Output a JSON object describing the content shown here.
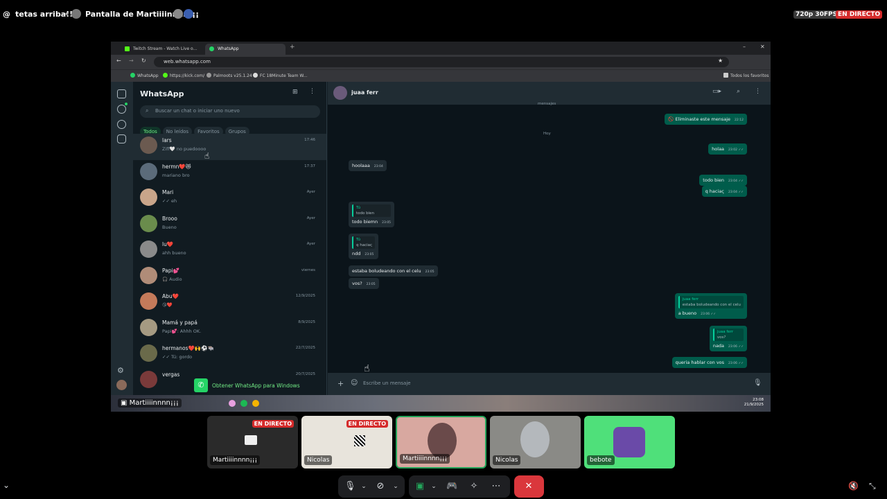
{
  "top": {
    "channel": "tetas arriba!!!",
    "stream_title": "Pantalla de Martiiiinnnn¡¡¡",
    "quality": "720p 30FPS",
    "live": "EN DIRECTO"
  },
  "browser": {
    "tabs": [
      "Twitch Stream - Watch Live o...",
      "WhatsApp"
    ],
    "url": "web.whatsapp.com",
    "bookmarks": [
      "WhatsApp",
      "https://kick.com/",
      "Palmoots v25.1.24",
      "FC 18Minute Team W..."
    ],
    "bookmarks_folder": "Todos los favoritos"
  },
  "whatsapp": {
    "title": "WhatsApp",
    "search_placeholder": "Buscar un chat o iniciar uno nuevo",
    "filters": [
      "Todos",
      "No leídos",
      "Favoritos",
      "Grupos"
    ],
    "chats": [
      {
        "name": "lars",
        "preview": "Ziff🤍 no puedoooo",
        "time": "17:46",
        "color": "#6b5a50"
      },
      {
        "name": "hermn❤️😻",
        "preview": "mariano bro",
        "time": "17:37",
        "color": "#5b6b7a"
      },
      {
        "name": "Mari",
        "preview": "✓✓ eh",
        "time": "Ayer",
        "color": "#c9a58a"
      },
      {
        "name": "Brooo",
        "preview": "Bueno",
        "time": "Ayer",
        "color": "#6a8c4c"
      },
      {
        "name": "lu❤️",
        "preview": "ahh bueno",
        "time": "Ayer",
        "color": "#8a8a8a"
      },
      {
        "name": "Papi💕",
        "preview": "🎧 Audio",
        "time": "viernes",
        "color": "#b08c78"
      },
      {
        "name": "Abu❤️",
        "preview": "😘❤️",
        "time": "12/9/2025",
        "color": "#c47a5a"
      },
      {
        "name": "Mamá y papá",
        "preview": "Papi💕: Ahhh OK.",
        "time": "8/9/2025",
        "color": "#a59a82"
      },
      {
        "name": "hermanos❤️🙌⚽🐃",
        "preview": "✓✓ Tú: gordo",
        "time": "22/7/2025",
        "color": "#6a6a4a"
      },
      {
        "name": "vergas",
        "preview": "",
        "time": "20/7/2025",
        "color": "#7a3a3a"
      }
    ],
    "get_windows": "Obtener WhatsApp para Windows",
    "contact": "juaa ferr",
    "composer_placeholder": "Escribe un mensaje",
    "messages": [
      {
        "type": "sys",
        "text": "mensajes"
      },
      {
        "type": "out",
        "text": "🚫 Eliminaste este mensaje",
        "time": "22:12"
      },
      {
        "type": "sys",
        "text": "Hoy"
      },
      {
        "type": "out",
        "text": "holaa",
        "time": "23:02 ✓✓"
      },
      {
        "type": "in",
        "text": "hoolaaa",
        "time": "23:04"
      },
      {
        "type": "out",
        "text": "todo bien",
        "time": "23:04 ✓✓"
      },
      {
        "type": "out",
        "text": "q haciaς",
        "time": "23:04 ✓✓"
      },
      {
        "type": "in",
        "quote_name": "Tú",
        "quote_text": "todo bien",
        "text": "todo biemn",
        "time": "23:05"
      },
      {
        "type": "in",
        "quote_name": "Tú",
        "quote_text": "q haciaς",
        "text": "ndd",
        "time": "23:05"
      },
      {
        "type": "in",
        "text": "estaba boludeando con el celu",
        "time": "23:05"
      },
      {
        "type": "in",
        "text": "vos?",
        "time": "23:05"
      },
      {
        "type": "out",
        "quote_name": "juaa ferr",
        "quote_text": "estaba boludeando con el celu",
        "text": "a bueno",
        "time": "23:06 ✓✓"
      },
      {
        "type": "out",
        "quote_name": "juaa ferr",
        "quote_text": "vos?",
        "text": "nada",
        "time": "23:06 ✓✓"
      },
      {
        "type": "out",
        "text": "queria hablar con vos",
        "time": "23:06 ✓✓"
      }
    ]
  },
  "taskbar": {
    "streamer_label": "Martiiiinnnn¡¡¡",
    "time": "23:08",
    "date": "21/9/2025"
  },
  "participants": [
    {
      "name": "Martiiiinnnn¡¡¡",
      "live": "EN DIRECTO",
      "bg": "#2a2a2a"
    },
    {
      "name": "Nicolas",
      "live": "EN DIRECTO",
      "bg": "#e8e4dc"
    },
    {
      "name": "Martiiiinnnn¡¡¡",
      "live": "",
      "bg": "#d8a8a0"
    },
    {
      "name": "Nicolas",
      "live": "",
      "bg": "#8a8a86"
    },
    {
      "name": "bebote",
      "live": "",
      "bg": "#4fe07a"
    }
  ]
}
